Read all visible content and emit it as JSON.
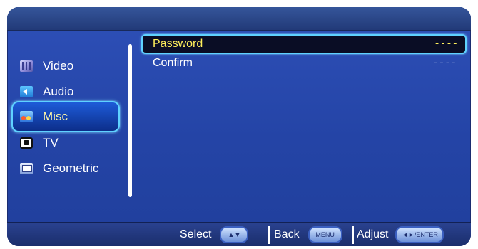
{
  "sidebar": {
    "items": [
      {
        "label": "Video",
        "icon": "video-icon"
      },
      {
        "label": "Audio",
        "icon": "audio-icon"
      },
      {
        "label": "Misc",
        "icon": "misc-icon",
        "selected": true
      },
      {
        "label": "TV",
        "icon": "tv-icon"
      },
      {
        "label": "Geometric",
        "icon": "geometric-icon"
      }
    ]
  },
  "content": {
    "rows": [
      {
        "label": "Password",
        "value": "----",
        "selected": true
      },
      {
        "label": "Confirm",
        "value": "----"
      }
    ]
  },
  "footer": {
    "select_label": "Select",
    "select_key": "▲▼",
    "back_label": "Back",
    "back_key": "MENU",
    "adjust_label": "Adjust",
    "adjust_key": "◄►/ENTER"
  },
  "colors": {
    "background": "#2546a8",
    "highlight_border": "#5fd2ff",
    "selected_text": "#ffef5c"
  }
}
